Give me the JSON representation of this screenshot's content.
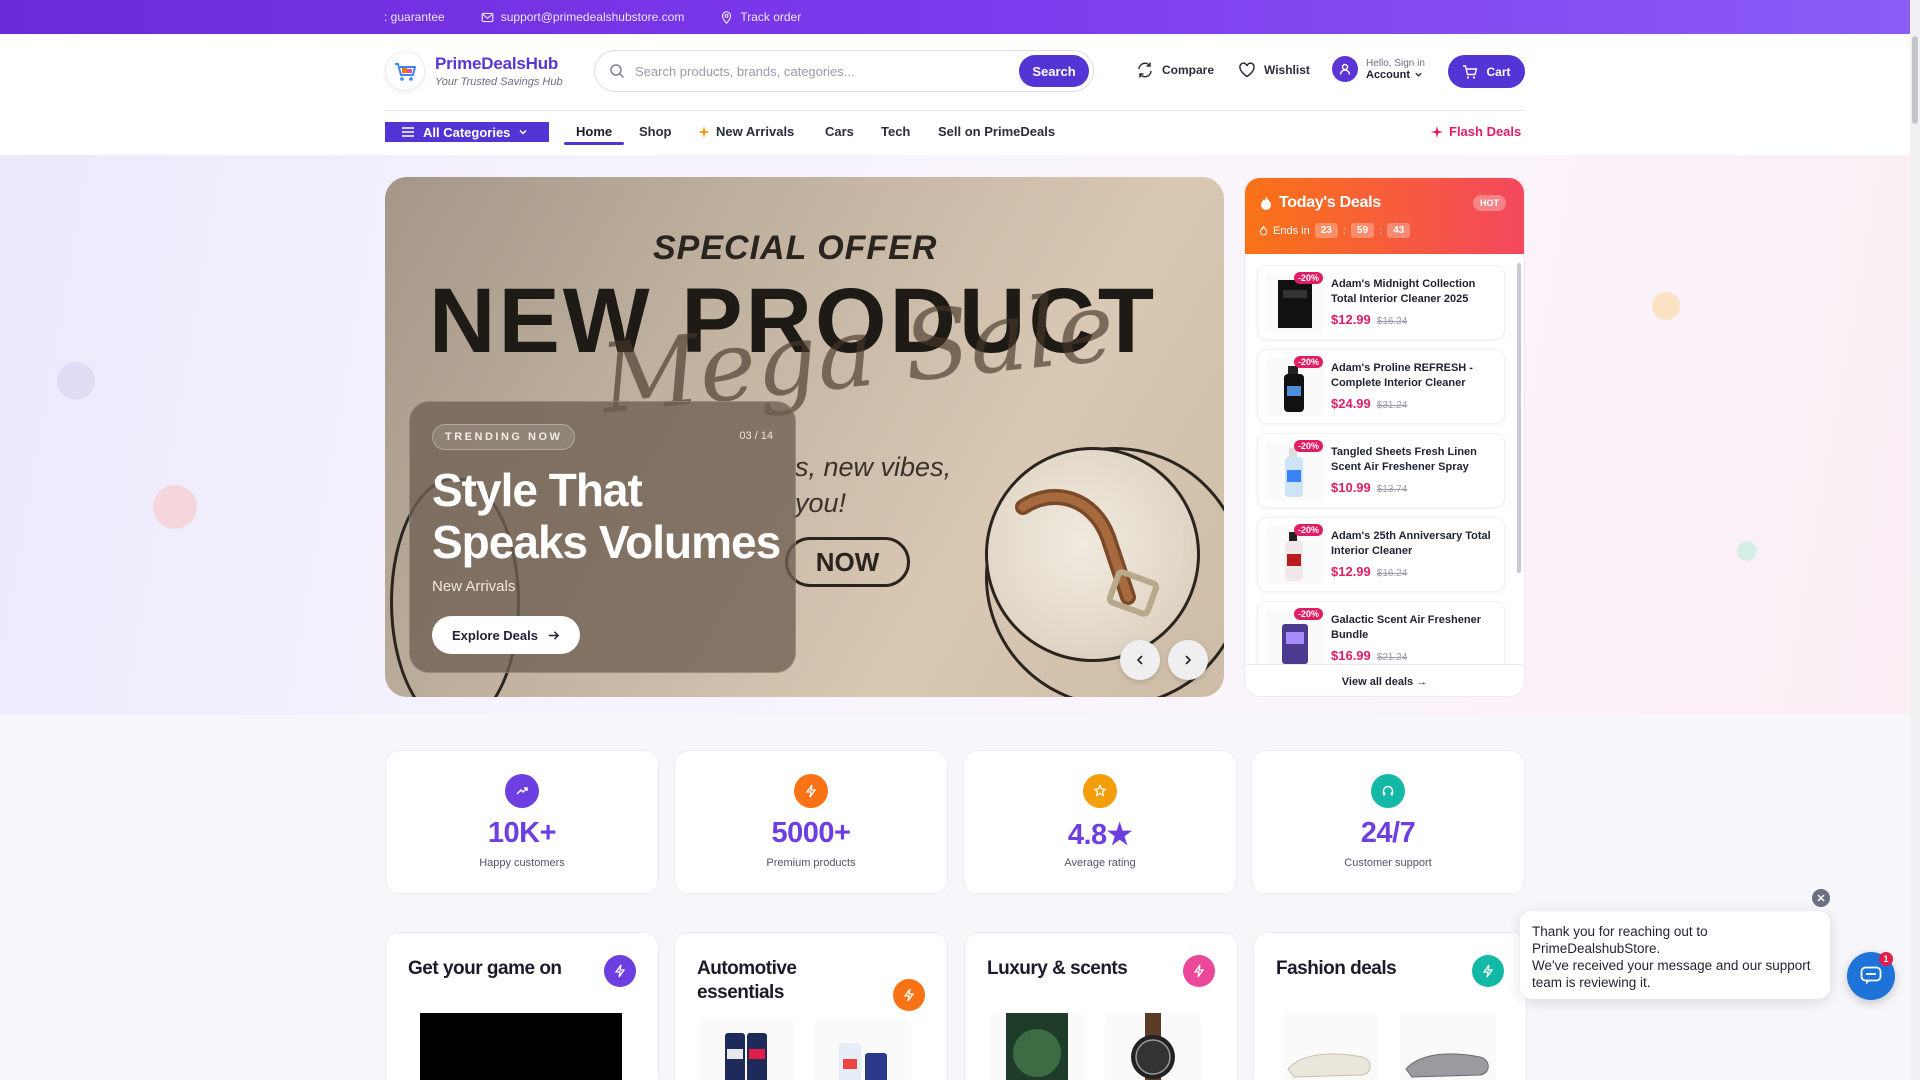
{
  "topbar": {
    "guarantee": ": guarantee",
    "email": "support@primedealshubstore.com",
    "track": "Track order"
  },
  "brand": {
    "name": "PrimeDealsHub",
    "tagline": "Your Trusted Savings Hub"
  },
  "search": {
    "placeholder": "Search products, brands, categories...",
    "button": "Search"
  },
  "header_actions": {
    "compare": "Compare",
    "wishlist": "Wishlist",
    "account_small": "Hello, Sign in",
    "account_big": "Account",
    "cart": "Cart"
  },
  "nav": {
    "all_categories": "All Categories",
    "items": [
      "Home",
      "Shop",
      "New Arrivals",
      "Cars",
      "Tech",
      "Sell on PrimeDeals"
    ],
    "flash": "Flash Deals"
  },
  "hero": {
    "special": "SPECIAL OFFER",
    "big": "NEW PRODUCT",
    "script": "Mega Sale",
    "sub_line1": "s, new vibes,",
    "sub_line2": "you!",
    "now": "NOW",
    "badge": "TRENDING NOW",
    "counter": "03 / 14",
    "title_line1": "Style That",
    "title_line2": "Speaks Volumes",
    "subtitle": "New Arrivals",
    "cta": "Explore Deals"
  },
  "deals": {
    "title": "Today's Deals",
    "hot": "HOT",
    "ends_label": "Ends in",
    "timer": [
      "23",
      "59",
      "43"
    ],
    "items": [
      {
        "name": "Adam's Midnight Collection Total Interior Cleaner 2025",
        "price": "$12.99",
        "old": "$16.24",
        "off": "-20%"
      },
      {
        "name": "Adam's Proline REFRESH - Complete Interior Cleaner",
        "price": "$24.99",
        "old": "$31.24",
        "off": "-20%"
      },
      {
        "name": "Tangled Sheets Fresh Linen Scent Air Freshener Spray",
        "price": "$10.99",
        "old": "$13.74",
        "off": "-20%"
      },
      {
        "name": "Adam's 25th Anniversary Total Interior Cleaner",
        "price": "$12.99",
        "old": "$16.24",
        "off": "-20%"
      },
      {
        "name": "Galactic Scent Air Freshener Bundle",
        "price": "$16.99",
        "old": "$21.24",
        "off": "-20%"
      }
    ],
    "footer": "View all deals →"
  },
  "stats": [
    {
      "value": "10K+",
      "label": "Happy customers",
      "color": "#6d3fe0"
    },
    {
      "value": "5000+",
      "label": "Premium products",
      "color": "#f97316"
    },
    {
      "value": "4.8★",
      "label": "Average rating",
      "color": "#f59e0b"
    },
    {
      "value": "24/7",
      "label": "Customer support",
      "color": "#14b8a6"
    }
  ],
  "categories": [
    {
      "title": "Get your game on",
      "color": "#6d3fe0"
    },
    {
      "title": "Automotive essentials",
      "color": "#f97316"
    },
    {
      "title": "Luxury & scents",
      "color": "#ec4899"
    },
    {
      "title": "Fashion deals",
      "color": "#14b8a6"
    }
  ],
  "chat": {
    "line1": "Thank you for reaching out to PrimeDealshubStore.",
    "line2": "We've received your message and our support team is reviewing it.",
    "count": "1"
  }
}
